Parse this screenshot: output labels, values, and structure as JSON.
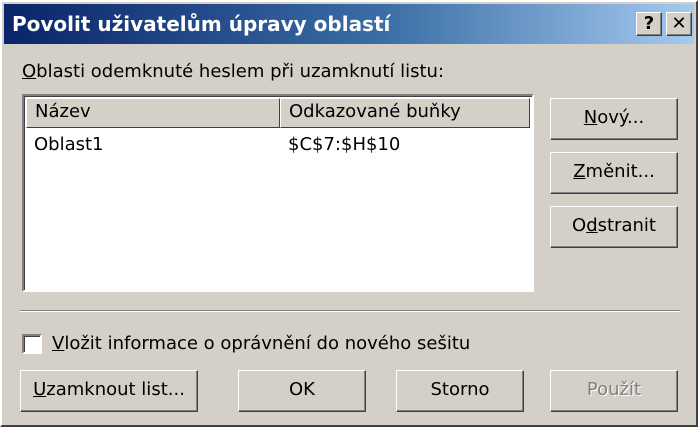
{
  "window": {
    "title": "Povolit uživatelům úpravy oblastí",
    "help_glyph": "?",
    "close_glyph": "✕"
  },
  "areas": {
    "label_accel": "O",
    "label_rest": "blasti odemknuté heslem při uzamknutí listu:",
    "columns": {
      "name": "Název",
      "cells": "Odkazované buňky"
    },
    "rows": [
      {
        "name": "Oblast1",
        "cells": "$C$7:$H$10"
      }
    ]
  },
  "buttons": {
    "new": {
      "accel": "N",
      "rest": "ový..."
    },
    "change": {
      "accel": "Z",
      "rest": "měnit..."
    },
    "remove": {
      "pre": "O",
      "accel": "d",
      "rest": "stranit"
    },
    "lock": {
      "accel": "U",
      "rest": "zamknout list..."
    },
    "ok": "OK",
    "cancel": "Storno",
    "apply": "Použít"
  },
  "checkbox": {
    "accel": "V",
    "rest": "ložit informace o oprávnění do nového sešitu",
    "checked": false
  }
}
